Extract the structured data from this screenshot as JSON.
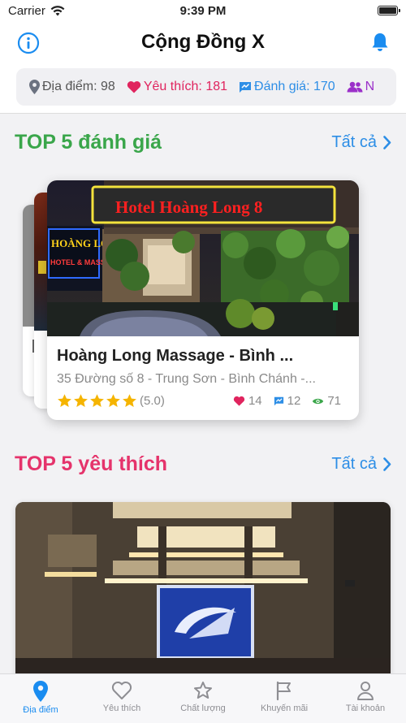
{
  "status_bar": {
    "carrier": "Carrier",
    "time": "9:39 PM",
    "battery_level": 1.0
  },
  "header": {
    "title": "Cộng Đồng X",
    "info_icon": "info-circle-icon",
    "bell_icon": "bell-icon"
  },
  "stats": [
    {
      "label": "Địa điểm: 98",
      "icon": "map-pin-icon",
      "color": "#6b7280"
    },
    {
      "label": "Yêu thích: 181",
      "icon": "heart-icon",
      "color": "#e0245e"
    },
    {
      "label": "Đánh giá: 170",
      "icon": "review-icon",
      "color": "#2d8ee6"
    },
    {
      "label": "N",
      "icon": "users-icon",
      "color": "#9b30c9"
    }
  ],
  "section_top_rated": {
    "title": "TOP 5 đánh giá",
    "title_color": "#3aa64a",
    "see_all": "Tất cả",
    "card": {
      "name": "Hoàng Long Massage - Bình ...",
      "address": "35 Đường số 8 - Trung Sơn - Bình Chánh -...",
      "rating": 5.0,
      "rating_text": "(5.0)",
      "likes": "14",
      "reviews": "12",
      "views": "71",
      "photo_sign_main": "Hotel Hoàng Long 8",
      "photo_sign_side": "HOÀNG LONG",
      "photo_sign_side2": "HOTEL & MASSAGE"
    }
  },
  "section_top_liked": {
    "title": "TOP 5 yêu thích",
    "title_color": "#e5336b",
    "see_all": "Tất cả"
  },
  "tabs": [
    {
      "label": "Địa điểm",
      "icon": "map-pin-icon",
      "active": true
    },
    {
      "label": "Yêu thích",
      "icon": "heart-outline-icon",
      "active": false
    },
    {
      "label": "Chất lượng",
      "icon": "star-outline-icon",
      "active": false
    },
    {
      "label": "Khuyến mãi",
      "icon": "flag-icon",
      "active": false
    },
    {
      "label": "Tài khoản",
      "icon": "user-icon",
      "active": false
    }
  ],
  "colors": {
    "accent": "#2d8ee6",
    "star": "#f5b400",
    "tab_active": "#1a8cf0"
  }
}
